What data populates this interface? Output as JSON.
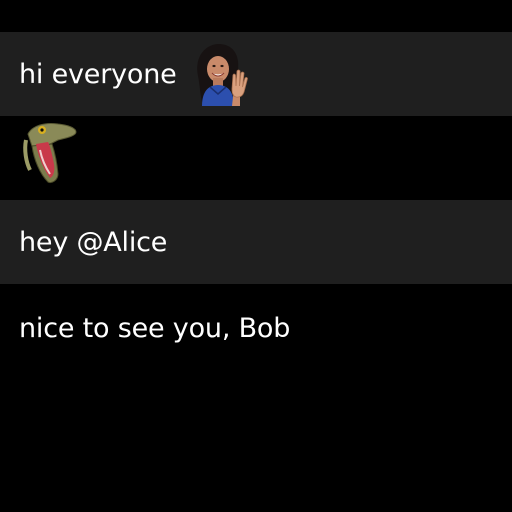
{
  "messages": [
    {
      "text": "hi everyone",
      "sticker": "waving-woman-sticker"
    },
    {
      "text": "",
      "sticker": "screaming-lizard-sticker"
    },
    {
      "text": "hey @Alice",
      "sticker": ""
    },
    {
      "text": "nice to see you, Bob",
      "sticker": ""
    }
  ],
  "colors": {
    "background": "#000000",
    "alternate_row": "#1f1f1f",
    "text": "#ffffff"
  }
}
